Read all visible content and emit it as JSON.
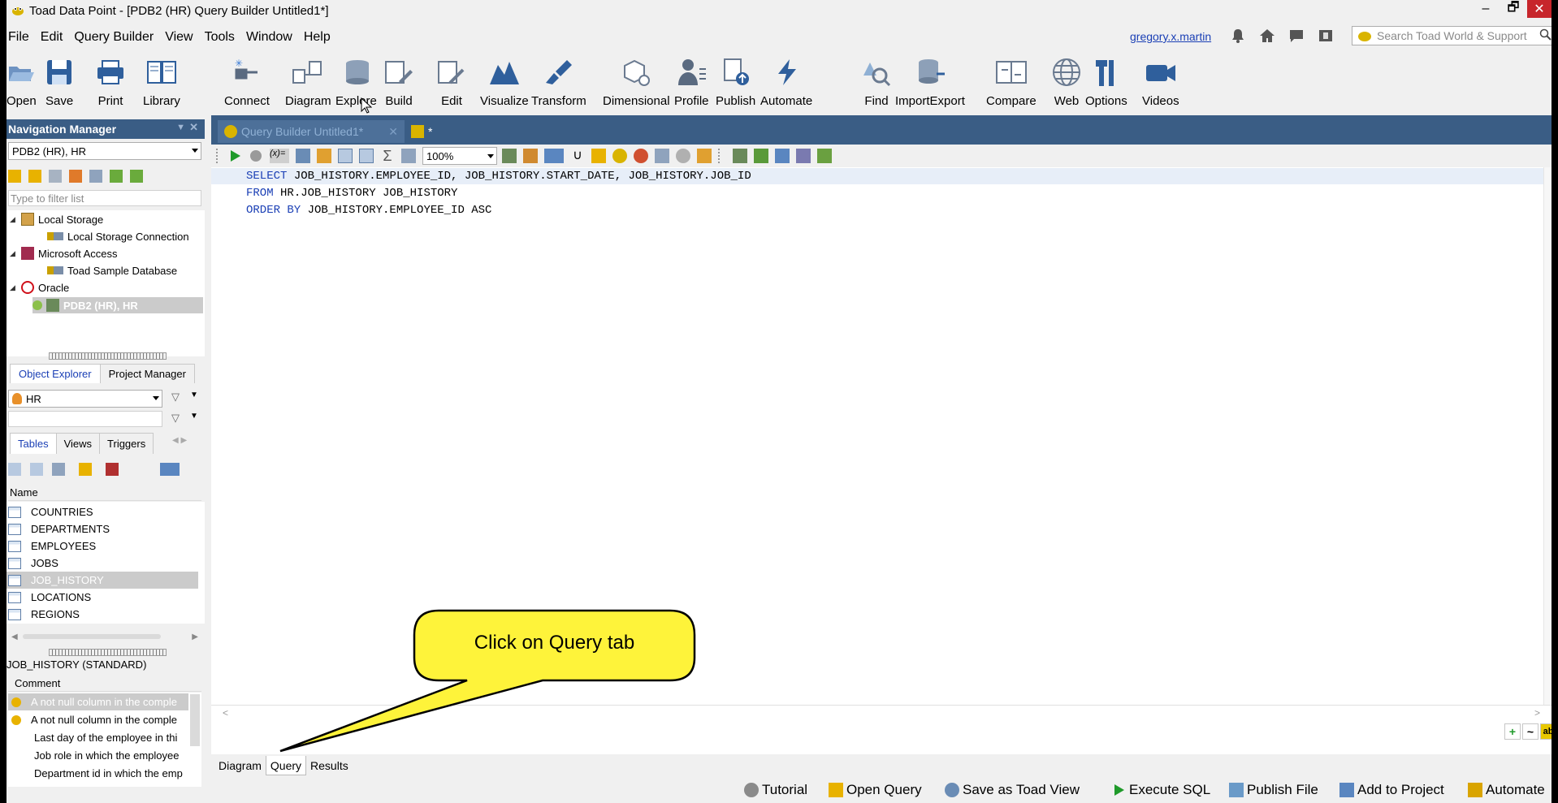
{
  "window": {
    "title": "Toad Data Point - [PDB2 (HR) Query Builder Untitled1*]",
    "controls": {
      "minimize": "–",
      "restore": "🗗",
      "close": "✕"
    }
  },
  "menu": [
    "File",
    "Edit",
    "Query Builder",
    "View",
    "Tools",
    "Window",
    "Help"
  ],
  "user": {
    "name": "gregory.x.martin"
  },
  "search": {
    "placeholder": "Search Toad World & Support"
  },
  "toolbar": {
    "buttons": [
      "Open",
      "Save",
      "Print",
      "Library",
      "Connect",
      "Diagram",
      "Explore",
      "Build",
      "Edit",
      "Visualize",
      "Transform",
      "Dimensional",
      "Profile",
      "Publish",
      "Automate",
      "Find",
      "ImportExport",
      "Compare",
      "Web",
      "Options",
      "Videos"
    ]
  },
  "nav": {
    "title": "Navigation Manager",
    "connection": "PDB2 (HR), HR",
    "filter_placeholder": "Type to filter list",
    "tree": {
      "local_storage": "Local Storage",
      "local_storage_conn": "Local Storage Connection",
      "ms_access": "Microsoft Access",
      "toad_sample": "Toad Sample Database",
      "oracle": "Oracle",
      "pdb2": "PDB2 (HR), HR"
    }
  },
  "explorer": {
    "tabs": [
      "Object Explorer",
      "Project Manager"
    ],
    "schema": "HR",
    "object_tabs": [
      "Tables",
      "Views",
      "Triggers"
    ],
    "column_header": "Name",
    "tables": [
      "COUNTRIES",
      "DEPARTMENTS",
      "EMPLOYEES",
      "JOBS",
      "JOB_HISTORY",
      "LOCATIONS",
      "REGIONS"
    ],
    "selected_table": "JOB_HISTORY",
    "detail_title": "JOB_HISTORY (STANDARD)",
    "detail_header": "Comment",
    "comments": [
      "A not null column in the comple",
      "A not null column in the comple",
      "Last day of the employee in thi",
      "Job role in which the employee",
      "Department id in which the emp"
    ]
  },
  "editor": {
    "tabs": [
      "Query Builder Untitled1*",
      "*"
    ],
    "zoom": "100%",
    "sql": {
      "line1_kw": "SELECT",
      "line1_rest": " JOB_HISTORY.EMPLOYEE_ID, JOB_HISTORY.START_DATE, JOB_HISTORY.JOB_ID",
      "line2_kw": "FROM",
      "line2_rest": " HR.JOB_HISTORY JOB_HISTORY",
      "line3_kw": "ORDER BY",
      "line3_rest": " JOB_HISTORY.EMPLOYEE_ID ASC"
    },
    "bottom_tabs": [
      "Diagram",
      "Query",
      "Results"
    ],
    "active_bottom_tab": "Query",
    "msg_buttons": [
      "+",
      "~",
      "ab"
    ]
  },
  "actions": [
    "Tutorial",
    "Open Query",
    "Save as Toad View",
    "Execute SQL",
    "Publish File",
    "Add to Project",
    "Automate"
  ],
  "callout": {
    "text": "Click on Query tab"
  },
  "colors": {
    "panel_header": "#3a5d85",
    "link": "#1a3fb5",
    "callout_fill": "#fef33a",
    "close_button": "#c7252b"
  }
}
